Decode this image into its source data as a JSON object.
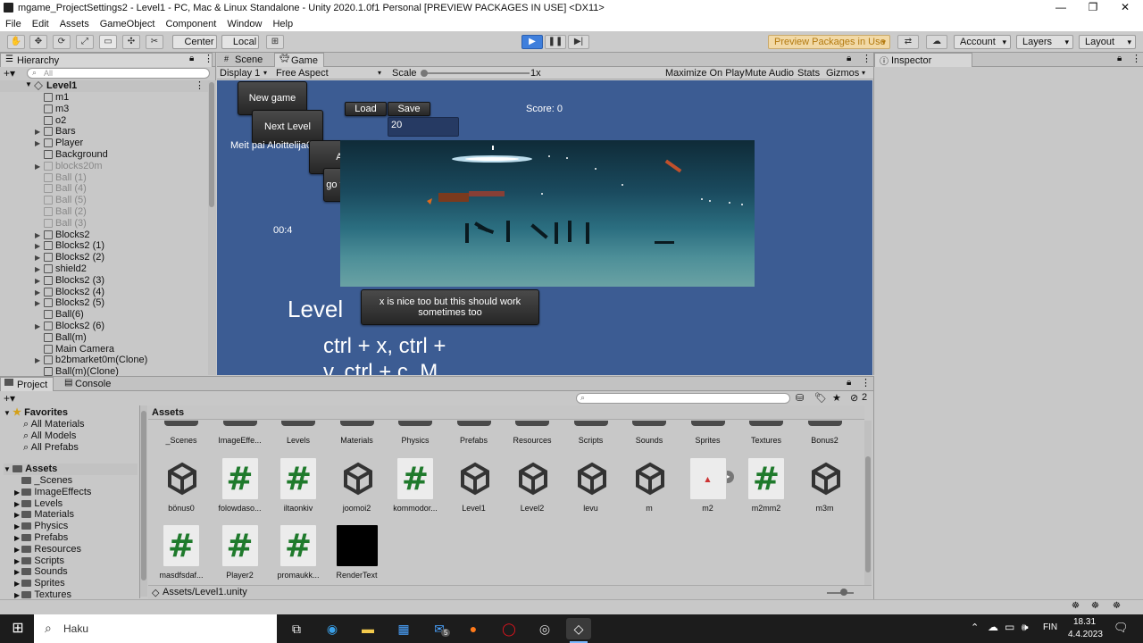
{
  "window": {
    "title": "mgame_ProjectSettings2 - Level1 - PC, Mac & Linux Standalone - Unity 2020.1.0f1 Personal [PREVIEW PACKAGES IN USE] <DX11>",
    "minimize": "—",
    "maximize": "❐",
    "close": "✕"
  },
  "menu": [
    "File",
    "Edit",
    "Assets",
    "GameObject",
    "Component",
    "Window",
    "Help"
  ],
  "toolbar": {
    "center": "Center",
    "local": "Local",
    "preview": "Preview Packages in Use",
    "account": "Account",
    "layers": "Layers",
    "layout": "Layout"
  },
  "hierarchy": {
    "title": "Hierarchy",
    "search_placeholder": "All",
    "scene": "Level1",
    "items": [
      {
        "label": "m1",
        "arrow": false,
        "disabled": false
      },
      {
        "label": "m3",
        "arrow": false,
        "disabled": false
      },
      {
        "label": "o2",
        "arrow": false,
        "disabled": false
      },
      {
        "label": "Bars",
        "arrow": true,
        "disabled": false
      },
      {
        "label": "Player",
        "arrow": true,
        "disabled": false
      },
      {
        "label": "Background",
        "arrow": false,
        "disabled": false
      },
      {
        "label": "blocks20m",
        "arrow": true,
        "disabled": true
      },
      {
        "label": "Ball (1)",
        "arrow": false,
        "disabled": true
      },
      {
        "label": "Ball (4)",
        "arrow": false,
        "disabled": true
      },
      {
        "label": "Ball (5)",
        "arrow": false,
        "disabled": true
      },
      {
        "label": "Ball (2)",
        "arrow": false,
        "disabled": true
      },
      {
        "label": "Ball (3)",
        "arrow": false,
        "disabled": true
      },
      {
        "label": "Blocks2",
        "arrow": true,
        "disabled": false
      },
      {
        "label": "Blocks2 (1)",
        "arrow": true,
        "disabled": false
      },
      {
        "label": "Blocks2 (2)",
        "arrow": true,
        "disabled": false
      },
      {
        "label": "shield2",
        "arrow": true,
        "disabled": false
      },
      {
        "label": "Blocks2 (3)",
        "arrow": true,
        "disabled": false
      },
      {
        "label": "Blocks2 (4)",
        "arrow": true,
        "disabled": false
      },
      {
        "label": "Blocks2 (5)",
        "arrow": true,
        "disabled": false
      },
      {
        "label": "Ball(6)",
        "arrow": false,
        "disabled": false
      },
      {
        "label": "Blocks2 (6)",
        "arrow": true,
        "disabled": false
      },
      {
        "label": "Ball(m)",
        "arrow": false,
        "disabled": false
      },
      {
        "label": "Main Camera",
        "arrow": false,
        "disabled": false
      },
      {
        "label": "b2bmarket0m(Clone)",
        "arrow": true,
        "disabled": false
      },
      {
        "label": "Ball(m)(Clone)",
        "arrow": false,
        "disabled": false
      }
    ]
  },
  "tabs": {
    "scene": "Scene",
    "game": "Game",
    "inspector": "Inspector",
    "project": "Project",
    "console": "Console"
  },
  "gamebar": {
    "display": "Display 1",
    "aspect": "Free Aspect",
    "scale_label": "Scale",
    "scale_value": "1x",
    "maximize": "Maximize On Play",
    "mute": "Mute Audio",
    "stats": "Stats",
    "gizmos": "Gizmos"
  },
  "game": {
    "new_game": "New game",
    "next_level": "Next Level",
    "load": "Load",
    "save": "Save",
    "input_value": "20",
    "score": "Score: 0",
    "player_text": "Meit pai Aloittelija00m02m",
    "add": "Add",
    "nice_level": "go to nice level",
    "timer": "00:4",
    "level_title": "Level",
    "x_note": "x is nice too but this should work sometimes too",
    "shortcuts_line1": "ctrl + x, ctrl +",
    "shortcuts_line2": "v, ctrl + c, M"
  },
  "project": {
    "assets_header": "Assets",
    "favorites": {
      "title": "Favorites",
      "items": [
        "All Materials",
        "All Models",
        "All Prefabs"
      ]
    },
    "tree_root": "Assets",
    "tree": [
      "_Scenes",
      "ImageEffects",
      "Levels",
      "Materials",
      "Physics",
      "Prefabs",
      "Resources",
      "Scripts",
      "Sounds",
      "Sprites",
      "Textures"
    ],
    "folders": [
      "_Scenes",
      "ImageEffe...",
      "Levels",
      "Materials",
      "Physics",
      "Prefabs",
      "Resources",
      "Scripts",
      "Sounds",
      "Sprites",
      "Textures",
      "Bonus2"
    ],
    "row2": [
      {
        "name": "bönus0",
        "kind": "unity"
      },
      {
        "name": "folowdaso...",
        "kind": "script"
      },
      {
        "name": "iltaonkiv",
        "kind": "script"
      },
      {
        "name": "joomoi2",
        "kind": "unity"
      },
      {
        "name": "kommodor...",
        "kind": "script"
      },
      {
        "name": "Level1",
        "kind": "unity"
      },
      {
        "name": "Level2",
        "kind": "unity"
      },
      {
        "name": "levu",
        "kind": "unity"
      },
      {
        "name": "m",
        "kind": "unity"
      },
      {
        "name": "m2",
        "kind": "sprite"
      },
      {
        "name": "m2mm2",
        "kind": "script"
      },
      {
        "name": "m3m",
        "kind": "unity"
      }
    ],
    "row3": [
      {
        "name": "masdfsdaf...",
        "kind": "script"
      },
      {
        "name": "Player2",
        "kind": "script"
      },
      {
        "name": "promaukk...",
        "kind": "script"
      },
      {
        "name": "RenderText",
        "kind": "black"
      }
    ],
    "path": "Assets/Level1.unity",
    "count": "2"
  },
  "taskbar": {
    "search": "Haku",
    "lang": "FIN",
    "time": "18.31",
    "date": "4.4.2023",
    "mail_badge": "5"
  }
}
